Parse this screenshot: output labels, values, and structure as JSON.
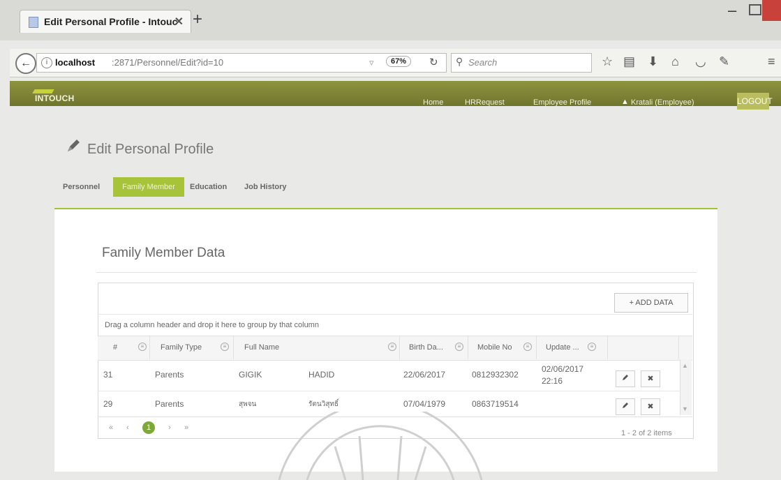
{
  "browser": {
    "tab_title": "Edit Personal Profile - Intouc",
    "close_glyph": "✕",
    "new_tab_glyph": "+",
    "url_host": "localhost",
    "url_path": ":2871/Personnel/Edit?id=10",
    "zoom": "67%",
    "search_placeholder": "Search",
    "icons": [
      "back-icon",
      "info-icon",
      "reload-icon",
      "search-icon",
      "bookmark-star-icon",
      "reading-list-icon",
      "download-icon",
      "home-icon",
      "pocket-icon",
      "extensions-icon",
      "menu-icon"
    ]
  },
  "app": {
    "logo": "INTOUCH",
    "nav": [
      "Home",
      "HRRequest",
      "Employee Profile"
    ],
    "user": "Kratali (Employee)",
    "logout": "LOGOUT",
    "page_title": "Edit Personal Profile",
    "tabs": [
      "Personnel",
      "Family Member",
      "Education",
      "Job History"
    ],
    "active_tab": "Family Member",
    "accent_color": "#9cc33a"
  },
  "grid": {
    "section_title": "Family Member Data",
    "add_button": "+ ADD DATA",
    "group_hint": "Drag a column header and drop it here to group by that column",
    "columns": [
      "#",
      "Family Type",
      "Full Name",
      "Birth Da...",
      "Mobile No",
      "Update ..."
    ],
    "rows": [
      {
        "id": "31",
        "family_type": "Parents",
        "first_name": "GIGIK",
        "last_name": "HADID",
        "birth_date": "22/06/2017",
        "mobile": "0812932302",
        "update_date": "02/06/2017",
        "update_time": "22:16"
      },
      {
        "id": "29",
        "family_type": "Parents",
        "first_name": "สุพจน",
        "last_name": "รัตนวิสุทธิ์",
        "birth_date": "07/04/1979",
        "mobile": "0863719514",
        "update_date": "",
        "update_time": ""
      }
    ],
    "pager": {
      "current_page": "1",
      "items_info": "1 - 2 of 2 items"
    }
  }
}
